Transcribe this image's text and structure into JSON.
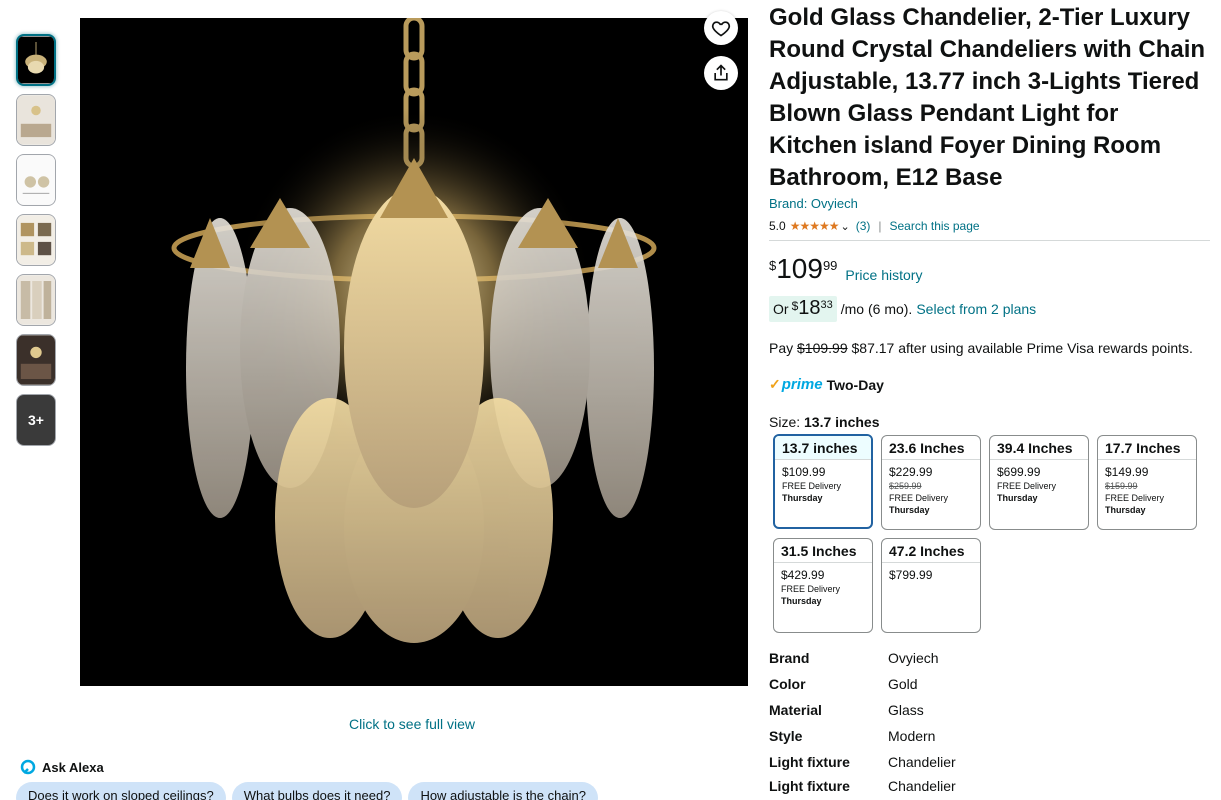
{
  "gallery": {
    "thumbnails": [
      {
        "name": "product-front",
        "selected": true
      },
      {
        "name": "room-scene"
      },
      {
        "name": "dimensions"
      },
      {
        "name": "detail-grid"
      },
      {
        "name": "room-gallery"
      },
      {
        "name": "dark-room"
      }
    ],
    "more_label": "3+",
    "full_view_label": "Click to see full view"
  },
  "ask_alexa": {
    "label": "Ask Alexa",
    "chips": [
      "Does it work on sloped ceilings?",
      "What bulbs does it need?",
      "How adjustable is the chain?"
    ]
  },
  "product": {
    "title": "Gold Glass Chandelier, 2-Tier Luxury Round Crystal Chandeliers with Chain Adjustable, 13.77 inch 3-Lights Tiered Blown Glass Pendant Light for Kitchen island Foyer Dining Room Bathroom, E12 Base",
    "brand_link": "Brand: Ovyiech",
    "rating_value": "5.0",
    "stars": "★★★★★",
    "rating_count": "(3)",
    "search_page": "Search this page"
  },
  "price": {
    "symbol": "$",
    "whole": "109",
    "fraction": "99",
    "history_label": "Price history"
  },
  "installment": {
    "or": "Or",
    "symbol": "$",
    "whole": "18",
    "fraction": "33",
    "suffix": "/mo (6 mo).",
    "link": "Select from 2 plans"
  },
  "rewards": {
    "prefix": "Pay",
    "old_price": "$109.99",
    "text": "$87.17 after using available Prime Visa rewards points."
  },
  "prime": {
    "check": "✓",
    "word": "prime",
    "label": "Two-Day"
  },
  "size": {
    "label": "Size:",
    "selected": "13.7 inches",
    "options": [
      {
        "name": "13.7 inches",
        "price": "$109.99",
        "old": "",
        "delivery": "FREE Delivery",
        "day": "Thursday"
      },
      {
        "name": "23.6 Inches",
        "price": "$229.99",
        "old": "$259.99",
        "delivery": "FREE Delivery",
        "day": "Thursday"
      },
      {
        "name": "39.4 Inches",
        "price": "$699.99",
        "old": "",
        "delivery": "FREE Delivery",
        "day": "Thursday"
      },
      {
        "name": "17.7 Inches",
        "price": "$149.99",
        "old": "$159.99",
        "delivery": "FREE Delivery",
        "day": "Thursday"
      },
      {
        "name": "31.5 Inches",
        "price": "$429.99",
        "old": "",
        "delivery": "FREE Delivery",
        "day": "Thursday"
      },
      {
        "name": "47.2 Inches",
        "price": "$799.99",
        "old": "",
        "delivery": "",
        "day": ""
      }
    ]
  },
  "specs": [
    {
      "key": "Brand",
      "value": "Ovyiech"
    },
    {
      "key": "Color",
      "value": "Gold"
    },
    {
      "key": "Material",
      "value": "Glass"
    },
    {
      "key": "Style",
      "value": "Modern"
    },
    {
      "key": "Light fixture",
      "value": "Chandelier"
    },
    {
      "key": "Light fixture",
      "value": "Chandelier"
    }
  ],
  "colors": {
    "link": "#007185",
    "star": "#de7921",
    "selected_border": "#2162a1",
    "prime_blue": "#00a8e1"
  }
}
